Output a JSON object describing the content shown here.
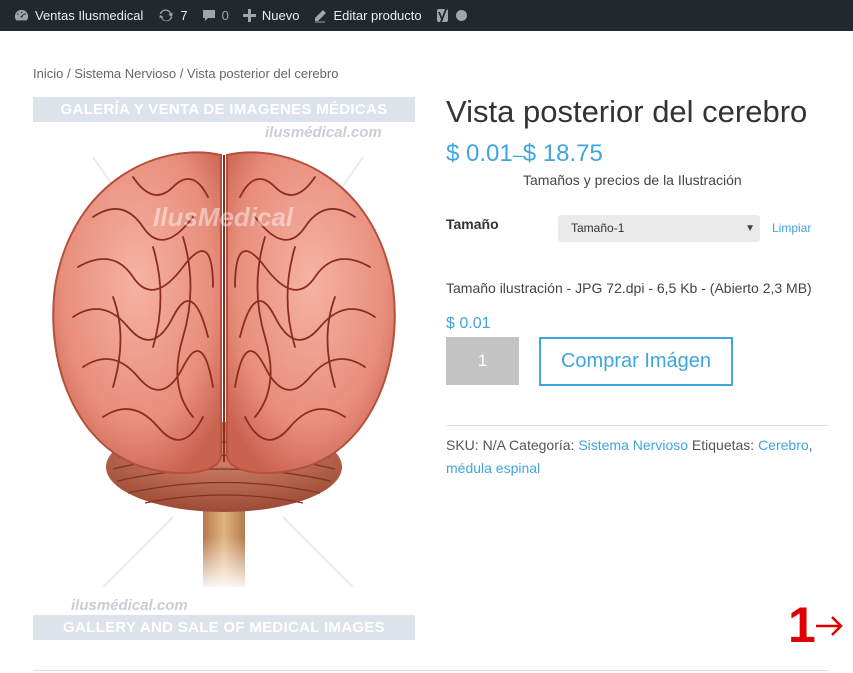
{
  "admin_bar": {
    "site_name": "Ventas Ilusmedical",
    "updates_count": "7",
    "comments_count": "0",
    "new_label": "Nuevo",
    "edit_label": "Editar producto"
  },
  "breadcrumb": {
    "home": "Inicio",
    "sep1": " / ",
    "category": "Sistema Nervioso",
    "sep2": " / ",
    "current": "Vista posterior del cerebro"
  },
  "image": {
    "top_band": "GALERÍA Y VENTA DE IMAGENES MÉDICAS",
    "top_site": "ilusmédical.com",
    "bottom_site": "ilusmédical.com",
    "bottom_band": "GALLERY AND SALE OF MEDICAL IMAGES",
    "watermark": "IlusMedical"
  },
  "product": {
    "title": "Vista posterior del cerebro",
    "price_min": "$ 0.01",
    "price_sep": "–",
    "price_max": "$ 18.75",
    "price_note": "Tamaños y precios de la Ilustración",
    "variation_label": "Tamaño",
    "variation_selected": "Tamaño-1",
    "clear_label": "Limpiar",
    "description": "Tamaño ilustración - JPG 72.dpi - 6,5 Kb - (Abierto 2,3 MB)",
    "variation_price": "$ 0.01",
    "quantity": "1",
    "buy_label": "Comprar Imágen"
  },
  "meta": {
    "sku_label": "SKU:",
    "sku_value": "N/A",
    "category_label": "Categoría:",
    "category_value": "Sistema Nervioso",
    "tags_label": "Etiquetas:",
    "tag1": "Cerebro",
    "tag_sep": ",",
    "tag2": "médula espinal"
  },
  "pagination": {
    "page": "1"
  },
  "colors": {
    "accent": "#3ea5e0",
    "admin_bar": "#23282d",
    "pager": "#e00000"
  },
  "icons": [
    "dashboard-icon",
    "updates-icon",
    "comments-icon",
    "plus-icon",
    "pencil-icon",
    "yoast-icon",
    "status-dot-icon",
    "arrow-right-icon"
  ]
}
